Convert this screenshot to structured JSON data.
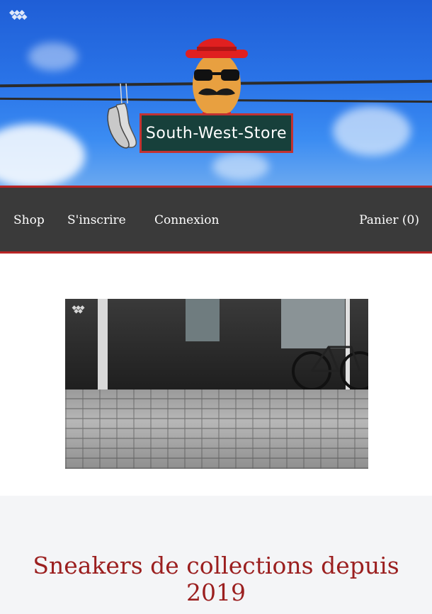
{
  "header": {
    "store_name": "South-West-Store",
    "logo_icon": "diamond-cluster-icon",
    "mascot_icon": "mustache-man-with-hat-icon",
    "shoes_icon": "hanging-sneakers-icon"
  },
  "nav": {
    "items": [
      {
        "label": "Shop"
      },
      {
        "label": "S'inscrire"
      },
      {
        "label": "Connexion"
      }
    ],
    "cart_label": "Panier (0)"
  },
  "hero_image": {
    "description_icon": "street-pavement-photo"
  },
  "main": {
    "headline": "Sneakers de collections depuis 2019"
  },
  "colors": {
    "sky": "#2a74e8",
    "nav_bg": "#3a3a3a",
    "accent_red": "#b82424",
    "sign_bg": "#17403b",
    "headline": "#9b1f1f"
  }
}
